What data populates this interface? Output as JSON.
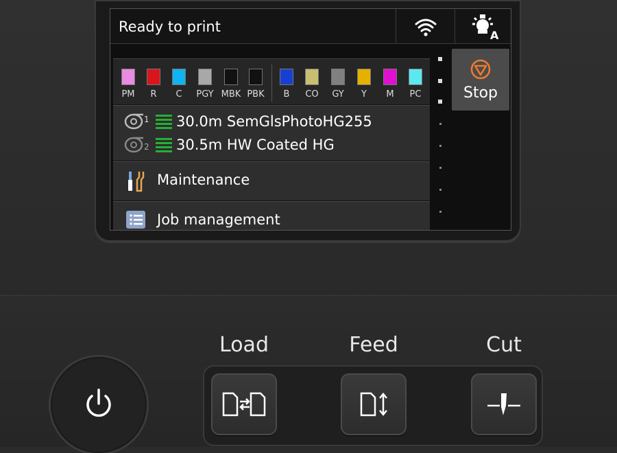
{
  "screen": {
    "status": "Ready to print",
    "inks": [
      {
        "label": "PM",
        "color": "#e98be0"
      },
      {
        "label": "R",
        "color": "#d8141d"
      },
      {
        "label": "C",
        "color": "#10b4ef"
      },
      {
        "label": "PGY",
        "color": "#a8a8a8"
      },
      {
        "label": "MBK",
        "color": "#111111"
      },
      {
        "label": "PBK",
        "color": "#111111"
      },
      {
        "label": "B",
        "color": "#1840d0"
      },
      {
        "label": "CO",
        "color": "#c8c070"
      },
      {
        "label": "GY",
        "color": "#808080"
      },
      {
        "label": "Y",
        "color": "#e5b000"
      },
      {
        "label": "M",
        "color": "#e010d0"
      },
      {
        "label": "PC",
        "color": "#5ce8f0"
      }
    ],
    "rolls": [
      {
        "num": "1",
        "text": "30.0m  SemGlsPhotoHG255"
      },
      {
        "num": "2",
        "text": "30.5m  HW Coated HG"
      }
    ],
    "maintenance_label": "Maintenance",
    "job_label": "Job management",
    "stop_label": "Stop"
  },
  "buttons": {
    "load": "Load",
    "feed": "Feed",
    "cut": "Cut"
  },
  "colors": {
    "level_green": "#25b035",
    "stop_orange": "#f07a2e"
  }
}
